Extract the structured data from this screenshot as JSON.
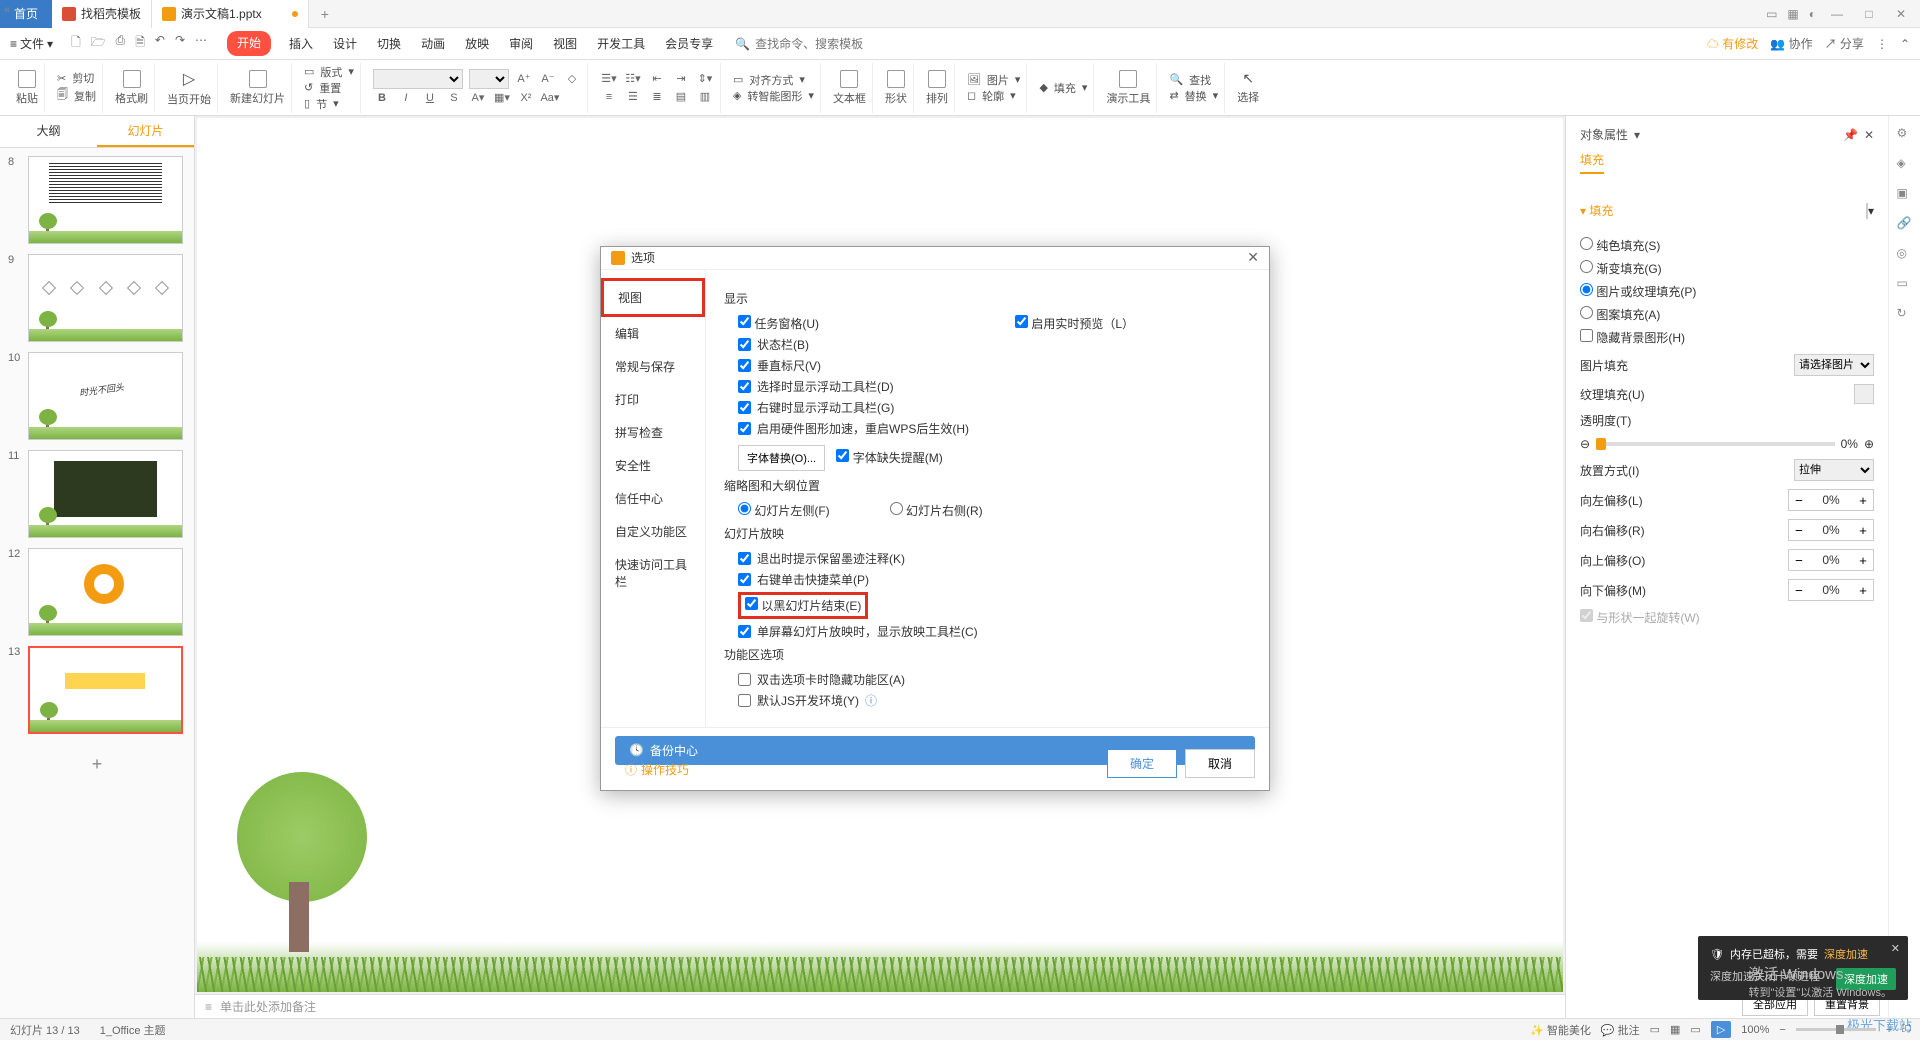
{
  "titlebar": {
    "home": "首页",
    "wps_tab": "找稻壳模板",
    "active_tab": "演示文稿1.pptx",
    "plus": "+"
  },
  "menubar": {
    "file": "文件",
    "tabs": [
      "开始",
      "插入",
      "设计",
      "切换",
      "动画",
      "放映",
      "审阅",
      "视图",
      "开发工具",
      "会员专享"
    ],
    "search_ph": "查找命令、搜索模板",
    "pending": "有修改",
    "coop": "协作",
    "share": "分享"
  },
  "ribbon": {
    "paste": "粘贴",
    "cut": "剪切",
    "copy": "复制",
    "brush": "格式刷",
    "from_current": "当页开始",
    "new_slide": "新建幻灯片",
    "layout": "版式",
    "section": "节",
    "reset": "重置",
    "align": "对齐方式",
    "textbox": "文本框",
    "shape": "形状",
    "arrange": "排列",
    "smart": "转智能图形",
    "image": "图片",
    "outline": "轮廓",
    "fill": "填充",
    "tools": "演示工具",
    "find": "查找",
    "replace": "替换",
    "select": "选择"
  },
  "slide_tabs": {
    "outline": "大纲",
    "slides": "幻灯片"
  },
  "slides": [
    {
      "num": "8"
    },
    {
      "num": "9"
    },
    {
      "num": "10"
    },
    {
      "num": "11"
    },
    {
      "num": "12"
    },
    {
      "num": "13"
    }
  ],
  "notes_placeholder": "单击此处添加备注",
  "dialog": {
    "title": "选项",
    "sidebar": [
      "视图",
      "编辑",
      "常规与保存",
      "打印",
      "拼写检查",
      "安全性",
      "信任中心",
      "自定义功能区",
      "快速访问工具栏"
    ],
    "display_section": "显示",
    "task_pane": "任务窗格(U)",
    "realtime_preview": "启用实时预览（L）",
    "status_bar": "状态栏(B)",
    "vruler": "垂直标尺(V)",
    "float_toolbar_select": "选择时显示浮动工具栏(D)",
    "float_toolbar_right": "右键时显示浮动工具栏(G)",
    "hw_accel": "启用硬件图形加速，重启WPS后生效(H)",
    "font_replace": "字体替换(O)...",
    "font_missing": "字体缺失提醒(M)",
    "thumb_section": "缩略图和大纲位置",
    "slide_left": "幻灯片左侧(F)",
    "slide_right": "幻灯片右侧(R)",
    "playback_section": "幻灯片放映",
    "exit_note": "退出时提示保留墨迹注释(K)",
    "right_menu": "右键单击快捷菜单(P)",
    "end_black": "以黑幻灯片结束(E)",
    "single_monitor": "单屏幕幻灯片放映时，显示放映工具栏(C)",
    "func_section": "功能区选项",
    "dbl_click_hide": "双击选项卡时隐藏功能区(A)",
    "js_dev": "默认JS开发环境(Y)",
    "backup": "备份中心",
    "tips": "操作技巧",
    "ok": "确定",
    "cancel": "取消"
  },
  "props": {
    "header": "对象属性",
    "tab": "填充",
    "fill_section": "填充",
    "solid": "纯色填充(S)",
    "gradient": "渐变填充(G)",
    "picture": "图片或纹理填充(P)",
    "pattern": "图案填充(A)",
    "hide_bg": "隐藏背景图形(H)",
    "pic_fill": "图片填充",
    "pic_select": "请选择图片",
    "texture": "纹理填充(U)",
    "opacity": "透明度(T)",
    "opacity_val": "0%",
    "place_mode": "放置方式(I)",
    "place_val": "拉伸",
    "off_left": "向左偏移(L)",
    "off_right": "向右偏移(R)",
    "off_up": "向上偏移(O)",
    "off_down": "向下偏移(M)",
    "off_val": "0%",
    "rotate": "与形状一起旋转(W)"
  },
  "footer": {
    "apply_all": "全部应用",
    "reset_bg": "重置背景"
  },
  "toast": {
    "title": "内存已超标，需要",
    "action_word": "深度加速",
    "desc": "深度加速关闭卡顿进程",
    "btn": "深度加速"
  },
  "activate": {
    "line1": "激活 Windows",
    "line2": "转到\"设置\"以激活 Windows。"
  },
  "watermark": "极光下载站",
  "status": {
    "slide_count": "幻灯片 13 / 13",
    "theme": "1_Office 主题",
    "smart": "智能美化",
    "note": "批注",
    "zoom": "100%"
  }
}
